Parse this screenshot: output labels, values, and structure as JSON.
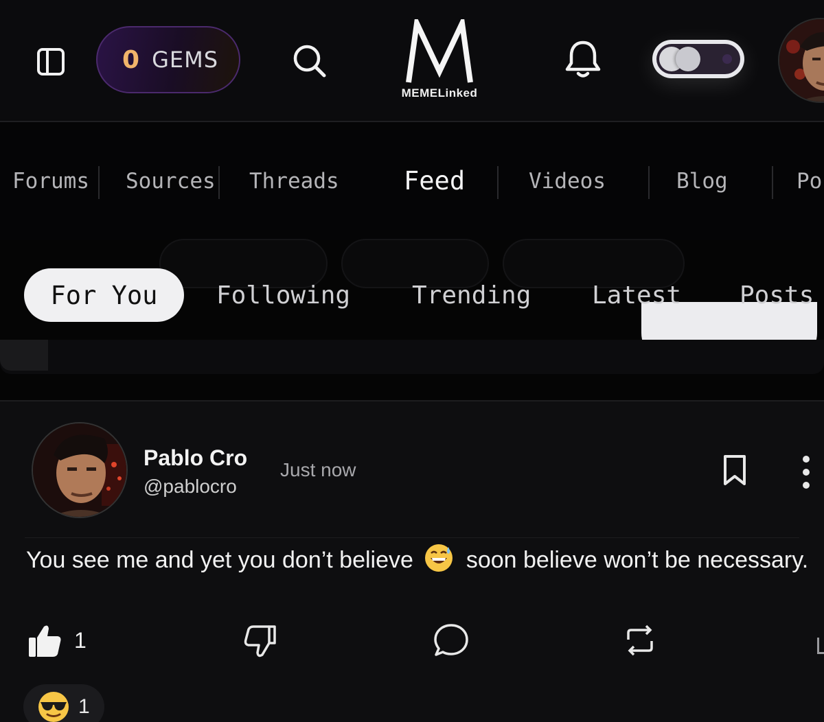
{
  "header": {
    "gems_count": "0",
    "gems_label": "GEMS",
    "logo_letter": "M",
    "logo_wordmark": "MEMELinked",
    "icons": [
      "sidebar-panel-icon",
      "search-icon",
      "bell-icon",
      "theme-toggle",
      "user-avatar"
    ]
  },
  "main_nav": {
    "items": [
      {
        "label": "Forums"
      },
      {
        "label": "Sources"
      },
      {
        "label": "Threads"
      },
      {
        "label": "Feed",
        "active": true
      },
      {
        "label": "Videos"
      },
      {
        "label": "Blog"
      },
      {
        "label": "Po"
      }
    ]
  },
  "sub_tabs": {
    "items": [
      {
        "label": "For You",
        "active": true
      },
      {
        "label": "Following"
      },
      {
        "label": "Trending"
      },
      {
        "label": "Latest"
      },
      {
        "label": "Posts"
      }
    ]
  },
  "post": {
    "author_name": "Pablo Cro",
    "author_handle": "@pablocro",
    "time": "Just now",
    "text_before": "You see me and yet you don’t believe",
    "text_after": "soon believe won’t be necessary.",
    "inline_emoji": "grinning-sweat-emoji",
    "likes": "1",
    "reaction_emoji": "sunglasses-emoji",
    "reaction_count": "1"
  },
  "colors": {
    "background": "#050505",
    "card": "#0e0e10",
    "gems_accent": "#f1b46a",
    "gems_border": "#4b2a6d",
    "active_tab_bg": "#f0f0f2"
  }
}
